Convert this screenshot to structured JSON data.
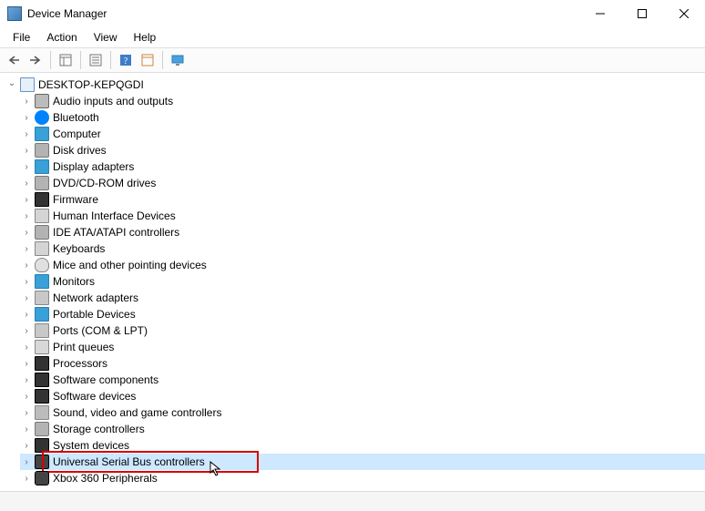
{
  "window": {
    "title": "Device Manager"
  },
  "menu": {
    "file": "File",
    "action": "Action",
    "view": "View",
    "help": "Help"
  },
  "tree": {
    "root": "DESKTOP-KEPQGDI",
    "items": [
      {
        "label": "Audio inputs and outputs",
        "icon": "speaker"
      },
      {
        "label": "Bluetooth",
        "icon": "bluetooth"
      },
      {
        "label": "Computer",
        "icon": "monitor"
      },
      {
        "label": "Disk drives",
        "icon": "disk"
      },
      {
        "label": "Display adapters",
        "icon": "monitor"
      },
      {
        "label": "DVD/CD-ROM drives",
        "icon": "disk"
      },
      {
        "label": "Firmware",
        "icon": "chip"
      },
      {
        "label": "Human Interface Devices",
        "icon": "keyboard"
      },
      {
        "label": "IDE ATA/ATAPI controllers",
        "icon": "disk"
      },
      {
        "label": "Keyboards",
        "icon": "keyboard"
      },
      {
        "label": "Mice and other pointing devices",
        "icon": "mouse"
      },
      {
        "label": "Monitors",
        "icon": "monitor"
      },
      {
        "label": "Network adapters",
        "icon": "net"
      },
      {
        "label": "Portable Devices",
        "icon": "monitor"
      },
      {
        "label": "Ports (COM & LPT)",
        "icon": "port"
      },
      {
        "label": "Print queues",
        "icon": "printer"
      },
      {
        "label": "Processors",
        "icon": "chip"
      },
      {
        "label": "Software components",
        "icon": "chip"
      },
      {
        "label": "Software devices",
        "icon": "chip"
      },
      {
        "label": "Sound, video and game controllers",
        "icon": "sound"
      },
      {
        "label": "Storage controllers",
        "icon": "disk"
      },
      {
        "label": "System devices",
        "icon": "chip"
      },
      {
        "label": "Universal Serial Bus controllers",
        "icon": "usb",
        "selected": true,
        "highlighted": true
      },
      {
        "label": "Xbox 360 Peripherals",
        "icon": "xbox"
      }
    ]
  }
}
